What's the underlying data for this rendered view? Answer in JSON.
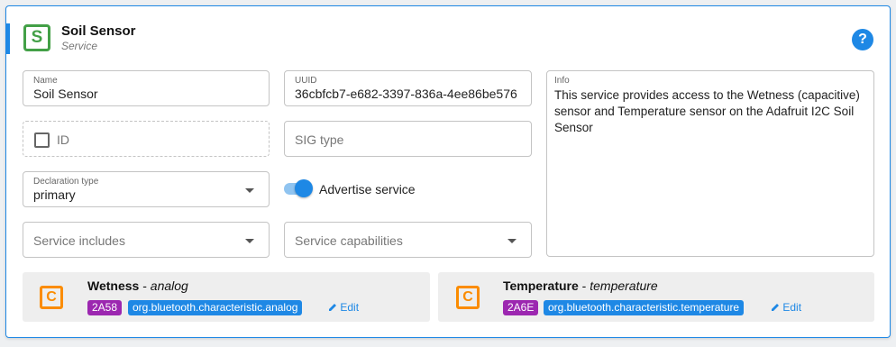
{
  "service": {
    "icon_letter": "S",
    "title": "Soil Sensor",
    "subtitle": "Service",
    "help_symbol": "?"
  },
  "fields": {
    "name": {
      "label": "Name",
      "value": "Soil Sensor"
    },
    "uuid": {
      "label": "UUID",
      "value": "36cbfcb7-e682-3397-836a-4ee86be576"
    },
    "id": {
      "placeholder": "ID",
      "checked": false
    },
    "sig_type": {
      "placeholder": "SIG type"
    },
    "declaration_type": {
      "label": "Declaration type",
      "value": "primary"
    },
    "advertise": {
      "label": "Advertise service",
      "on": true
    },
    "service_includes": {
      "placeholder": "Service includes"
    },
    "service_capabilities": {
      "placeholder": "Service capabilities"
    },
    "info": {
      "label": "Info",
      "value": "This service provides access to the Wetness (capacitive) sensor and Temperature sensor on the Adafruit I2C Soil Sensor"
    }
  },
  "characteristics": [
    {
      "icon_letter": "C",
      "name": "Wetness",
      "separator": " - ",
      "kind": "analog",
      "uuid": "2A58",
      "type": "org.bluetooth.characteristic.analog",
      "edit_label": "Edit"
    },
    {
      "icon_letter": "C",
      "name": "Temperature",
      "separator": " - ",
      "kind": "temperature",
      "uuid": "2A6E",
      "type": "org.bluetooth.characteristic.temperature",
      "edit_label": "Edit"
    }
  ],
  "colors": {
    "accent": "#1e88e5",
    "service_icon": "#43a047",
    "characteristic_icon": "#fb8c00",
    "uuid_badge": "#9c27b0",
    "type_badge": "#1e88e5"
  },
  "icons": {
    "help": "help-circle-icon",
    "edit": "pencil-icon",
    "dropdown": "chevron-down-icon"
  }
}
